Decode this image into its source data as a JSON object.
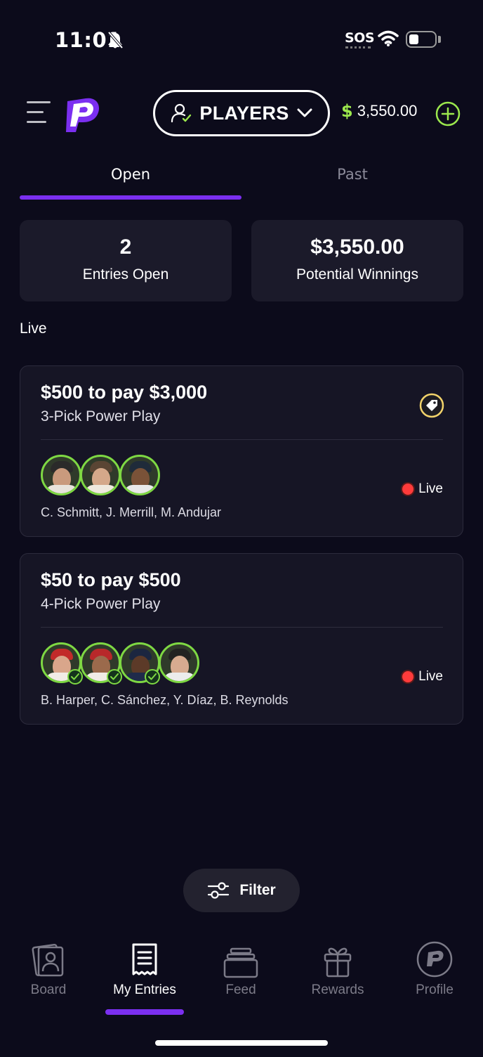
{
  "status_bar": {
    "time": "11:01",
    "sos": "SOS"
  },
  "header": {
    "mode_label": "PLAYERS",
    "balance_symbol": "$",
    "balance_value": "3,550.00",
    "accent_color": "#7b2ff0",
    "money_color": "#9ce84d"
  },
  "tabs": [
    {
      "label": "Open",
      "active": true
    },
    {
      "label": "Past",
      "active": false
    }
  ],
  "stats": [
    {
      "value": "2",
      "label": "Entries Open"
    },
    {
      "value": "$3,550.00",
      "label": "Potential Winnings"
    }
  ],
  "section_label": "Live",
  "entries": [
    {
      "title": "$500 to pay $3,000",
      "subtitle": "3-Pick Power Play",
      "status": "Live",
      "players": "C. Schmitt, J. Merrill, M. Andujar",
      "has_promo_tag": true,
      "avatar_count": 3
    },
    {
      "title": "$50 to pay $500",
      "subtitle": "4-Pick Power Play",
      "status": "Live",
      "players": "B. Harper, C. Sánchez, Y. Díaz, B. Reynolds",
      "has_promo_tag": false,
      "avatar_count": 4
    }
  ],
  "filter": {
    "label": "Filter"
  },
  "nav": [
    {
      "label": "Board",
      "icon": "board-icon",
      "active": false
    },
    {
      "label": "My Entries",
      "icon": "receipt-icon",
      "active": true
    },
    {
      "label": "Feed",
      "icon": "feed-icon",
      "active": false
    },
    {
      "label": "Rewards",
      "icon": "gift-icon",
      "active": false
    },
    {
      "label": "Profile",
      "icon": "profile-logo-icon",
      "active": false
    }
  ]
}
